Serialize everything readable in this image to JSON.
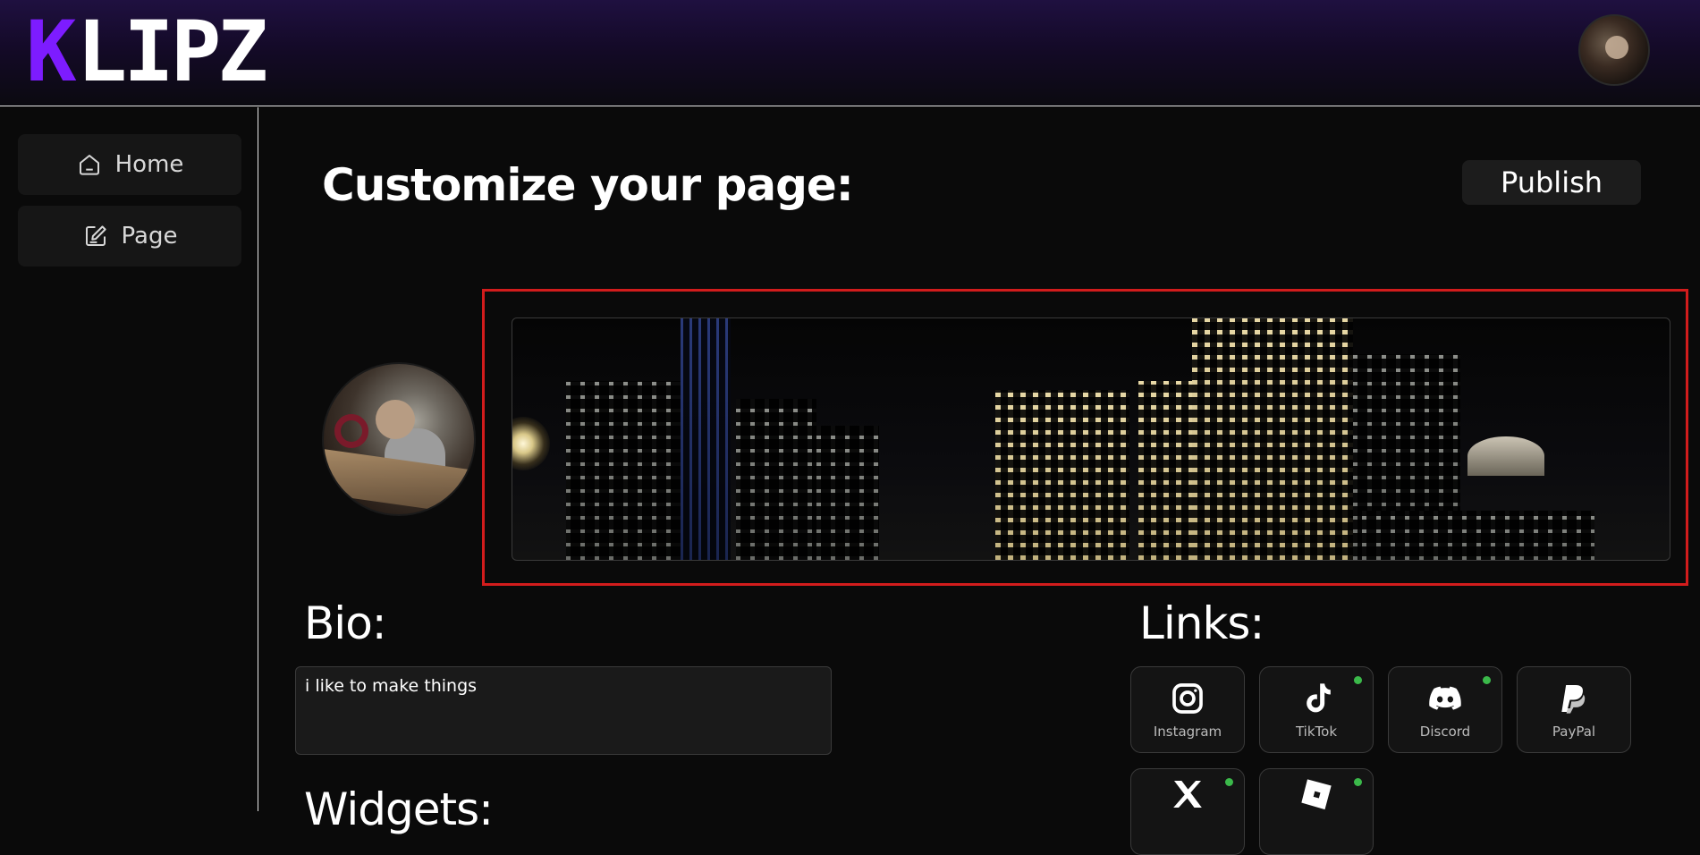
{
  "header": {
    "logo_k": "K",
    "logo_rest": "LIPZ"
  },
  "sidebar": {
    "items": [
      {
        "label": "Home",
        "icon": "home-icon"
      },
      {
        "label": "Page",
        "icon": "edit-page-icon"
      }
    ]
  },
  "main": {
    "title": "Customize your page:",
    "publish_label": "Publish",
    "bio_heading": "Bio:",
    "bio_value": "i like to make things",
    "links_heading": "Links:",
    "widgets_heading": "Widgets:"
  },
  "links": [
    {
      "label": "Instagram",
      "icon": "instagram-icon",
      "active": false
    },
    {
      "label": "TikTok",
      "icon": "tiktok-icon",
      "active": true
    },
    {
      "label": "Discord",
      "icon": "discord-icon",
      "active": true
    },
    {
      "label": "PayPal",
      "icon": "paypal-icon",
      "active": false
    },
    {
      "label": "",
      "icon": "x-icon",
      "active": true
    },
    {
      "label": "",
      "icon": "roblox-icon",
      "active": true
    }
  ],
  "colors": {
    "accent": "#7d1cff",
    "highlight_border": "#d21c1c",
    "status_active": "#3bb94a"
  }
}
